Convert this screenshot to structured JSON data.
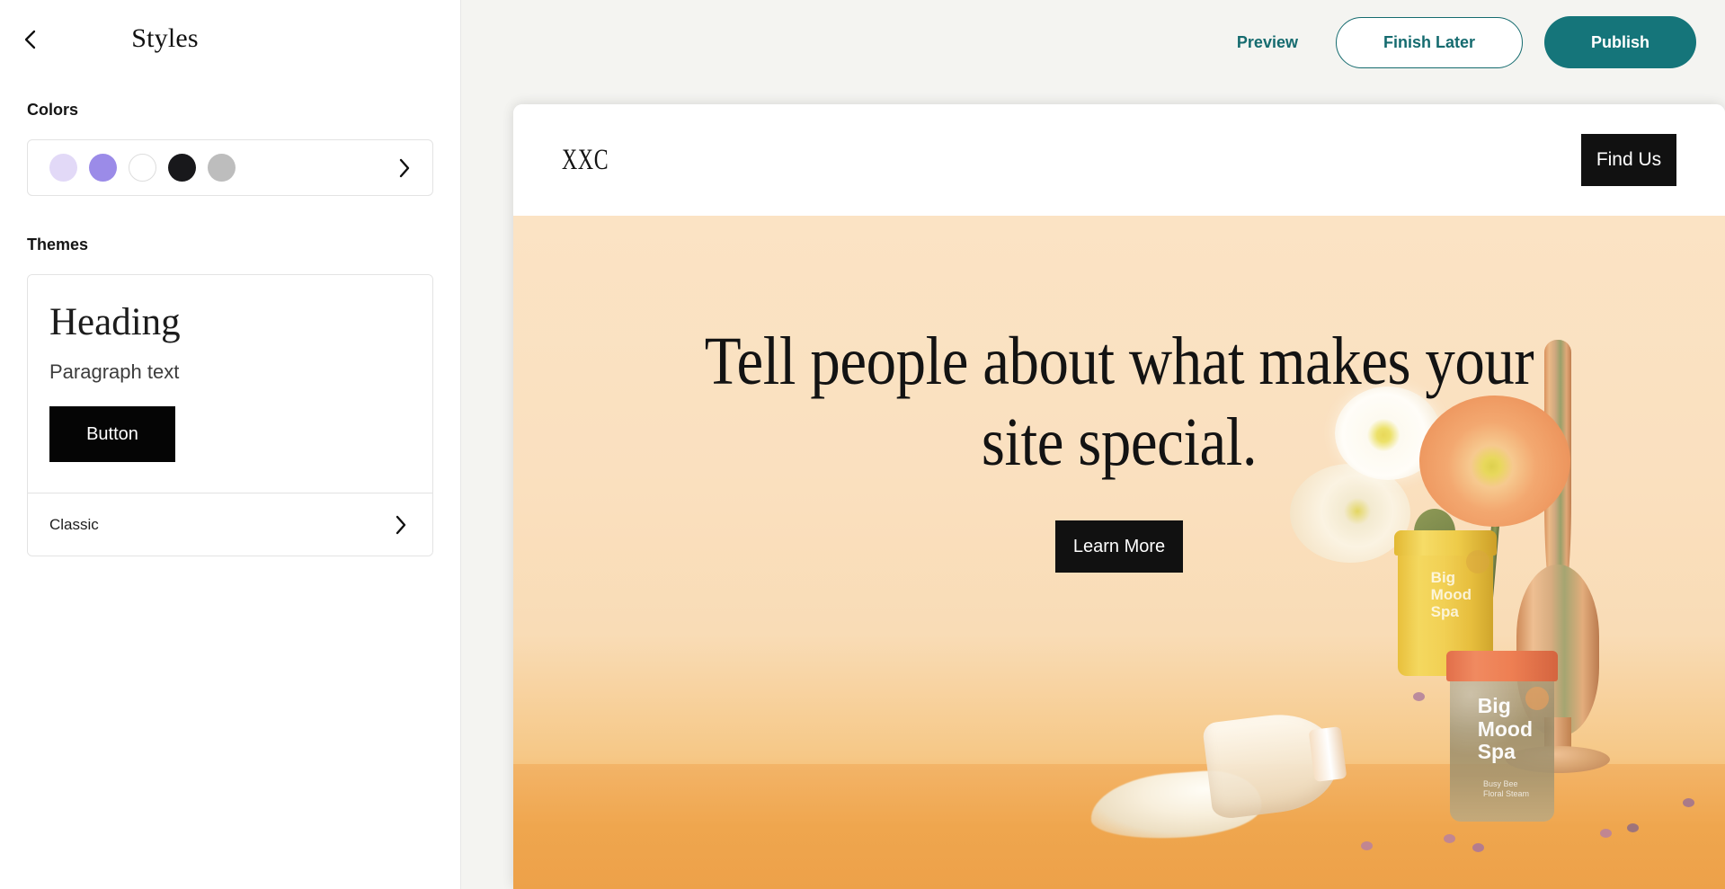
{
  "sidebar": {
    "back_icon": "chevron-left-icon",
    "title": "Styles",
    "colors": {
      "label": "Colors",
      "swatches": [
        "#e2d9f7",
        "#9b8be8",
        "#ffffff",
        "#18181b",
        "#bdbdbd"
      ],
      "chevron_icon": "chevron-right-icon"
    },
    "themes": {
      "label": "Themes",
      "preview": {
        "heading": "Heading",
        "paragraph": "Paragraph text",
        "button_label": "Button",
        "button_bg": "#050505"
      },
      "selected_theme": "Classic",
      "chevron_icon": "chevron-right-icon"
    }
  },
  "topbar": {
    "preview_label": "Preview",
    "finish_later_label": "Finish Later",
    "publish_label": "Publish",
    "accent_color": "#15757a"
  },
  "site_preview": {
    "nav": {
      "logo": "XXC",
      "cta_label": "Find Us"
    },
    "hero": {
      "headline": "Tell people about what makes your site special.",
      "cta_label": "Learn More",
      "background_top": "#fbe3c4",
      "background_bottom": "#f0ab56",
      "product_labels": {
        "yellow_jar": "Big\nMood\nSpa",
        "clear_jar": "Big\nMood\nSpa",
        "clear_jar_sub": "Busy Bee\nFloral Steam"
      }
    }
  }
}
